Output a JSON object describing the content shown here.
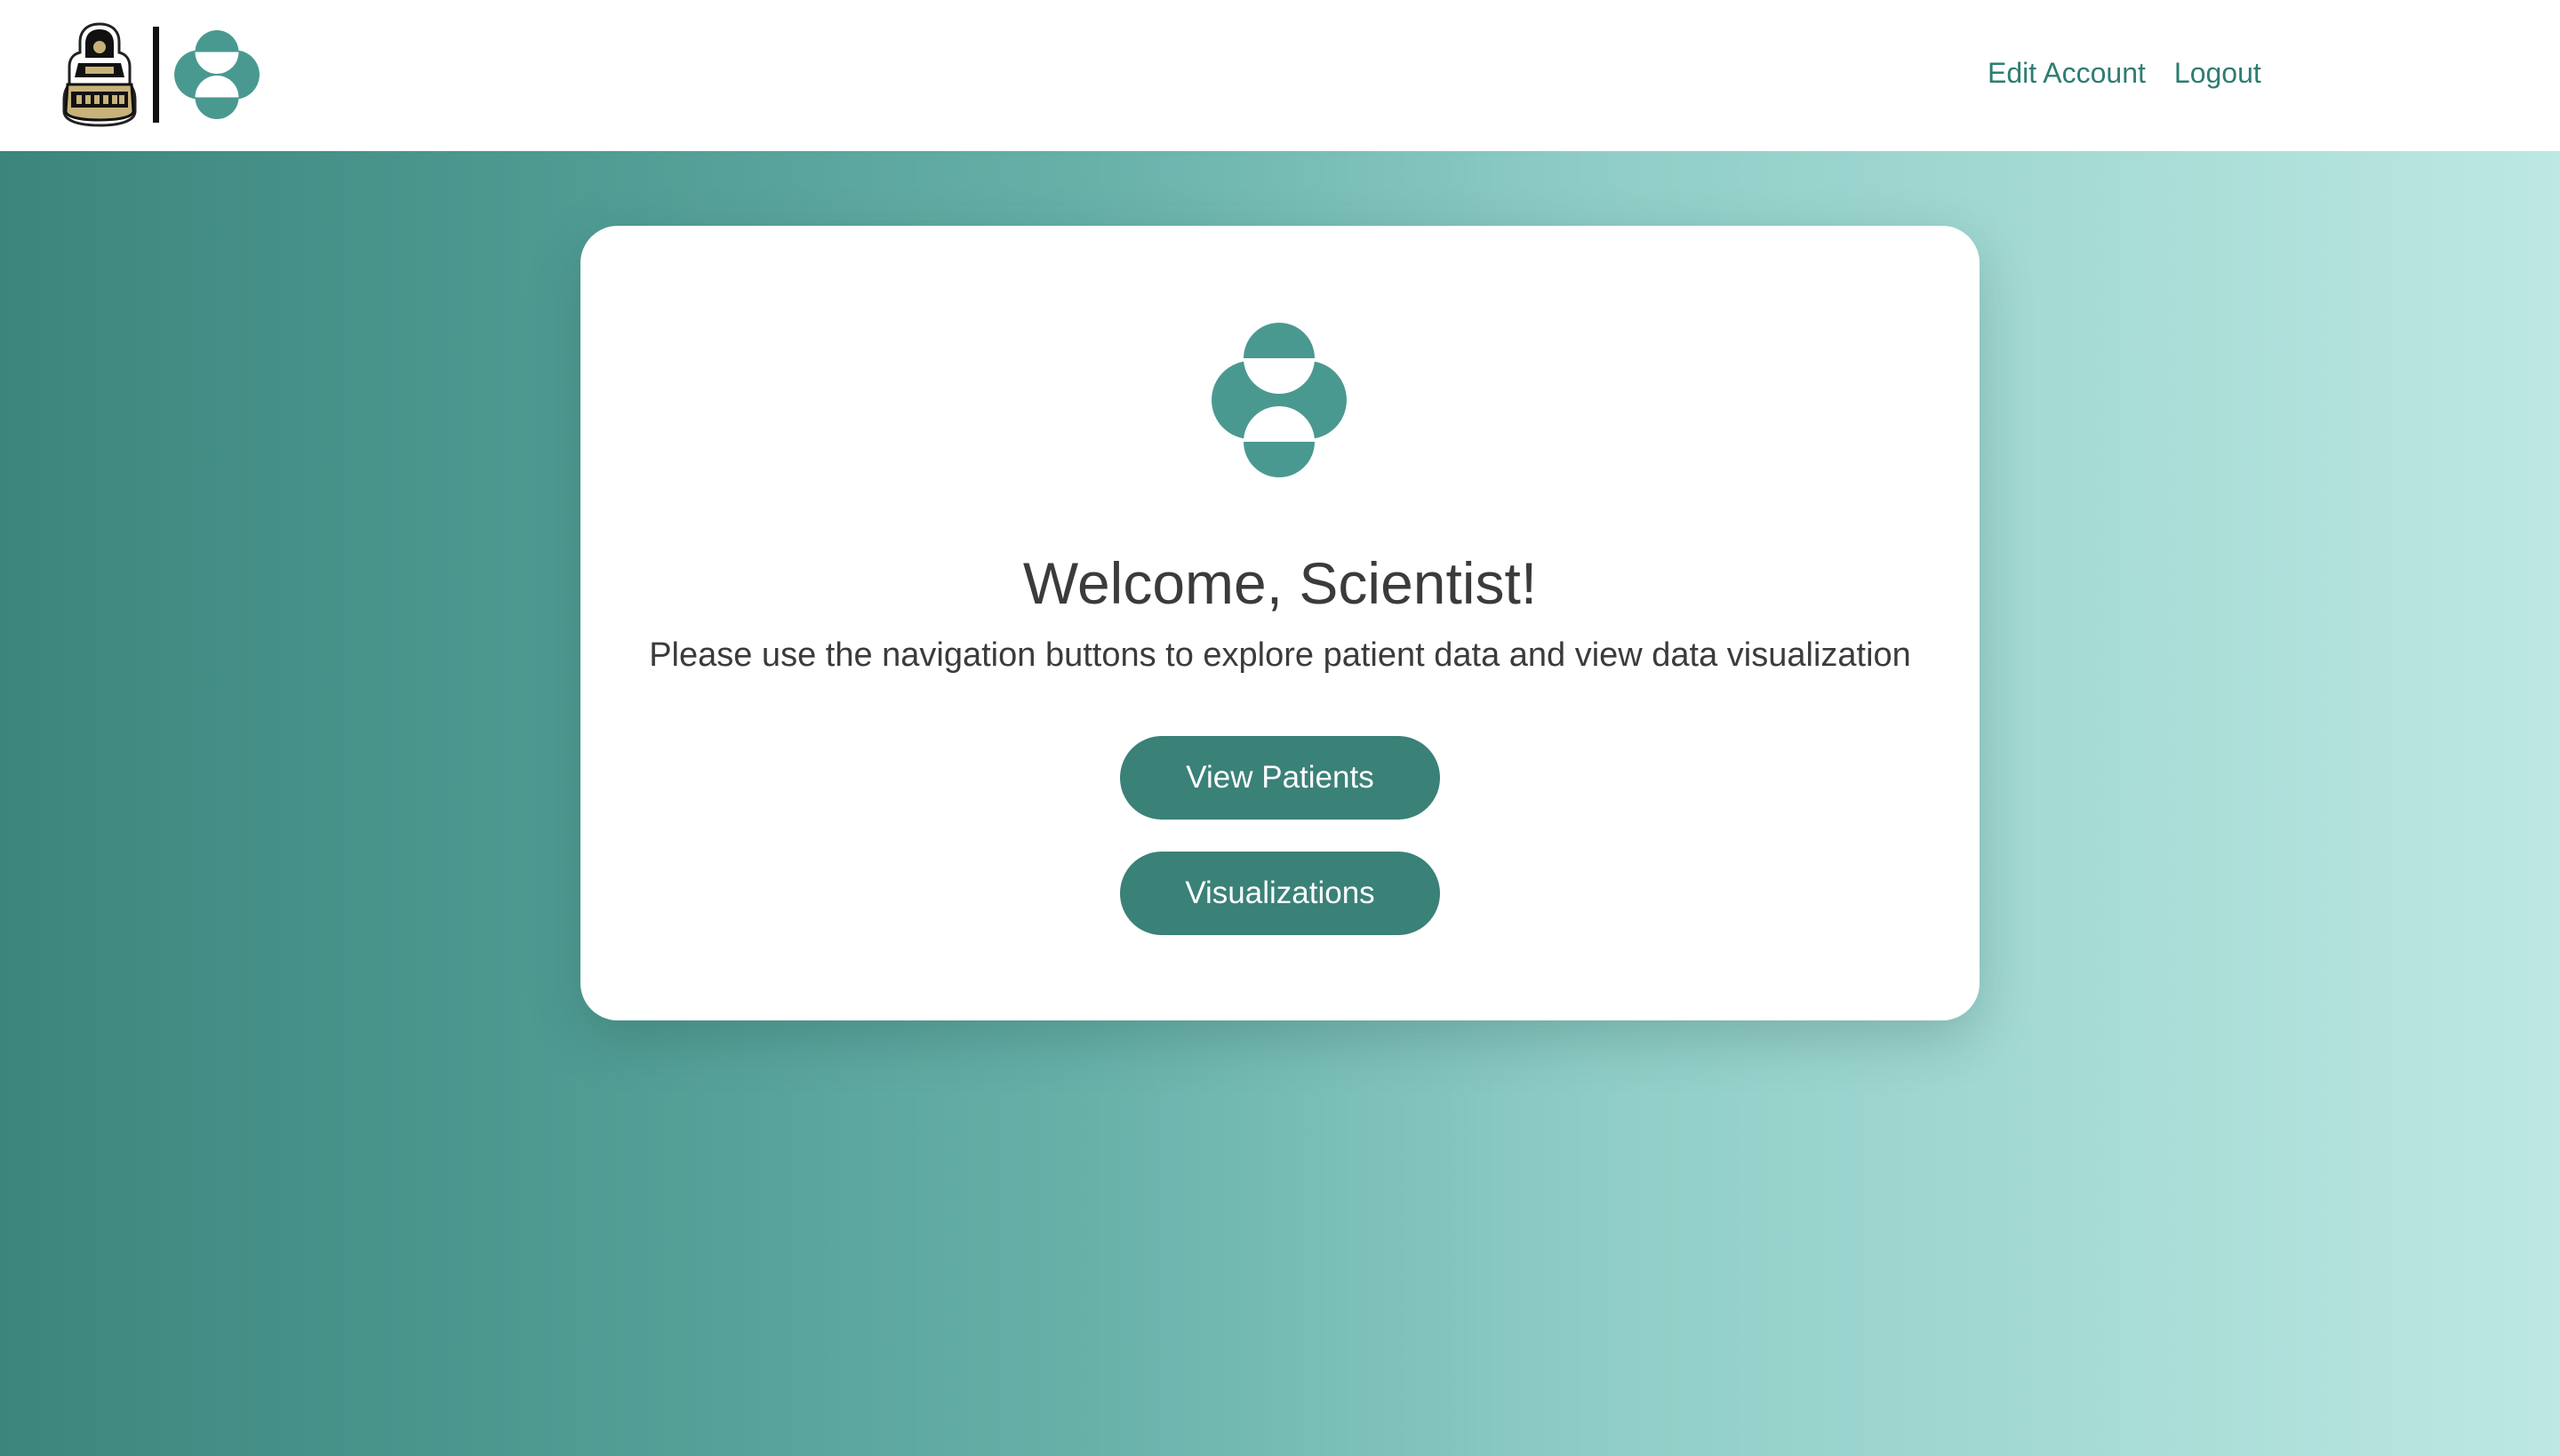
{
  "header": {
    "logos": [
      "purdue-logo",
      "brand-logo"
    ],
    "nav": {
      "edit_account": "Edit Account",
      "logout": "Logout"
    }
  },
  "main": {
    "logo": "brand-logo",
    "title": "Welcome, Scientist!",
    "subtitle": "Please use the navigation buttons to explore patient data and view data visualization",
    "buttons": {
      "view_patients": "View Patients",
      "visualizations": "Visualizations"
    }
  },
  "colors": {
    "accent": "#3a8178",
    "link": "#2d7d72",
    "gradient_start": "#3c857d",
    "gradient_end": "#bde8e3",
    "text": "#3b3b3b"
  }
}
